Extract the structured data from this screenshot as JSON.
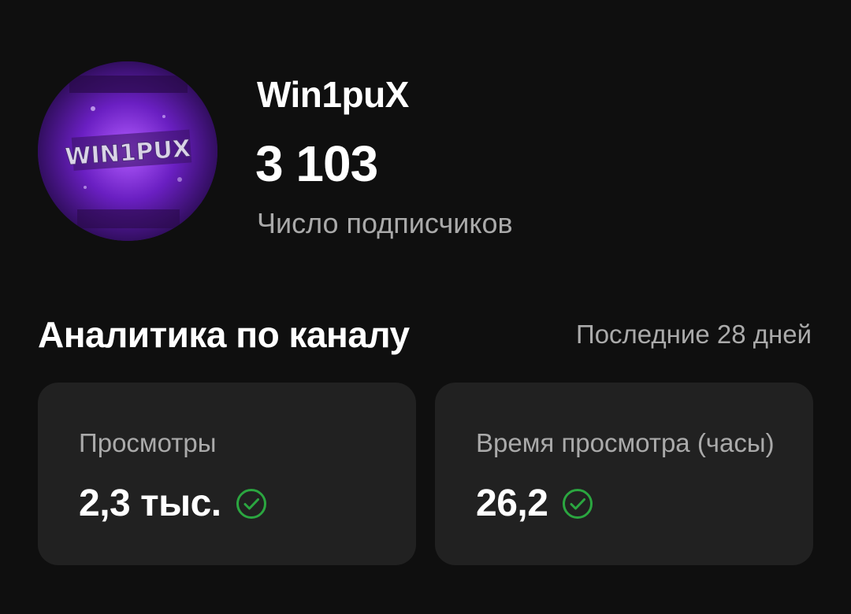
{
  "channel": {
    "name": "Win1puX",
    "avatar_text": "WIN1PUX",
    "subscribers_value": "3 103",
    "subscribers_label": "Число подписчиков"
  },
  "analytics": {
    "title": "Аналитика по каналу",
    "period": "Последние 28 дней",
    "cards": [
      {
        "label": "Просмотры",
        "value": "2,3 тыс.",
        "status_icon": "check-circle-icon"
      },
      {
        "label": "Время просмотра (часы)",
        "value": "26,2",
        "status_icon": "check-circle-icon"
      }
    ]
  },
  "colors": {
    "background": "#0f0f0f",
    "card": "#212121",
    "secondary_text": "#aaaaaa",
    "success_green": "#2ba640",
    "avatar_purple": "#8a2be2"
  }
}
